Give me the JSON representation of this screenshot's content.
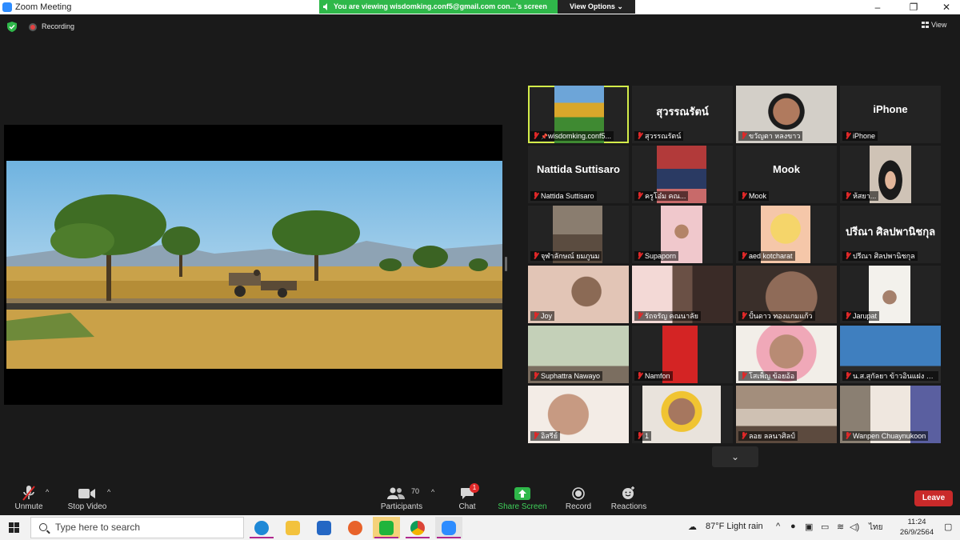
{
  "window": {
    "title": "Zoom Meeting",
    "minimize": "–",
    "maximize": "❐",
    "close": "✕"
  },
  "banner": {
    "text": "You are viewing wisdomking.conf5@gmail.com con...'s screen",
    "options": "View Options ⌄"
  },
  "status": {
    "recording": "Recording",
    "view": "View"
  },
  "participants_tiles": [
    {
      "name": "wisdomking.conf5...",
      "video": "landscape",
      "active": true,
      "pinned": true
    },
    {
      "name": "สุวรรณรัตน์",
      "big": "สุวรรณรัตน์"
    },
    {
      "name": "ขวัญตา หลงขาว",
      "video": "face-pink"
    },
    {
      "name": "iPhone",
      "big": "iPhone"
    },
    {
      "name": "Nattida Suttisaro",
      "big": "Nattida Suttisaro"
    },
    {
      "name": "ครูโอ๋ม คณ...",
      "video": "flowers"
    },
    {
      "name": "Mook",
      "big": "Mook"
    },
    {
      "name": "ห้สยา...",
      "video": "hijab"
    },
    {
      "name": "จุฬาลักษณ์ ยมภูนม",
      "video": "room"
    },
    {
      "name": "Supaporn",
      "video": "pink-wall"
    },
    {
      "name": "aed kotcharat",
      "video": "anime"
    },
    {
      "name": "ปรีณา ศิลปพานิชกุล",
      "big": "ปรีณา ศิลปพานิชกุล"
    },
    {
      "name": "Joy",
      "video": "mask"
    },
    {
      "name": "รัถจรัญ คณนาลัย",
      "video": "curtain"
    },
    {
      "name": "ปั้นดาว ทองแกมแก้ว",
      "video": "close-face"
    },
    {
      "name": "Jarupat",
      "video": "white-room"
    },
    {
      "name": "Suphattra Nawayo",
      "video": "green-curtain"
    },
    {
      "name": "Namfon",
      "video": "red"
    },
    {
      "name": "โสเพ็ญ ข้อยอ้อ",
      "video": "glasses"
    },
    {
      "name": "น.ส.สุกัลยา ข้าวอินแฝง คณน...",
      "video": "blue-wall"
    },
    {
      "name": "อิสรีย์",
      "video": "glasses2"
    },
    {
      "name": "1",
      "video": "yellow"
    },
    {
      "name": "ลอย ลลนาศิลป์",
      "video": "office"
    },
    {
      "name": "Wanpen Chuaynukoon",
      "video": "shelves"
    }
  ],
  "toolbar": {
    "unmute": "Unmute",
    "stop_video": "Stop Video",
    "participants": "Participants",
    "participants_count": "70",
    "chat": "Chat",
    "chat_badge": "1",
    "share_screen": "Share Screen",
    "record": "Record",
    "reactions": "Reactions",
    "leave": "Leave"
  },
  "taskbar": {
    "search_placeholder": "Type here to search",
    "weather": "87°F  Light rain",
    "lang": "ไทย",
    "time": "11:24",
    "date": "26/9/2564"
  },
  "colors": {
    "share_green": "#2fb84a",
    "active_border": "#d3ec4a",
    "leave_red": "#c92a2a",
    "muted_red": "#e02828"
  }
}
